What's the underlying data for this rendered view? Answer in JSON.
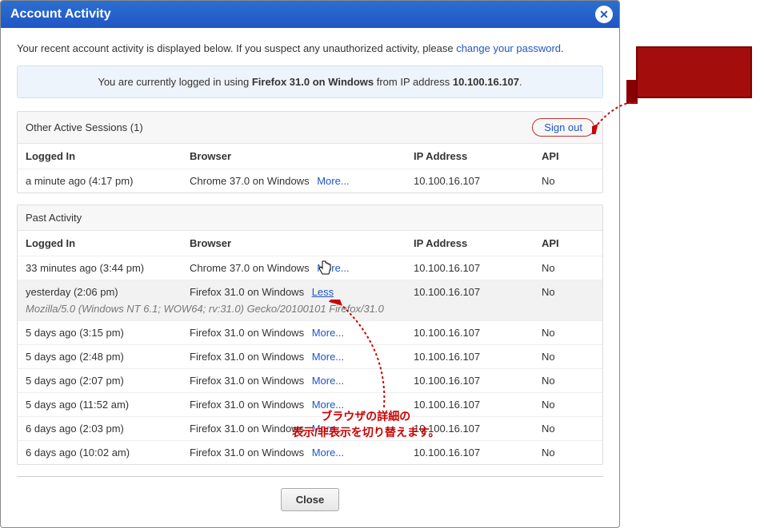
{
  "header": {
    "title": "Account Activity"
  },
  "intro": {
    "text": "Your recent account activity is displayed below. If you suspect any unauthorized activity, please ",
    "link": "change your password",
    "suffix": "."
  },
  "banner": {
    "prefix": "You are currently logged in using ",
    "browser": "Firefox 31.0 on Windows",
    "mid": " from IP address ",
    "ip": "10.100.16.107",
    "suffix": "."
  },
  "active_sessions": {
    "title": "Other Active Sessions (1)",
    "signout": "Sign out"
  },
  "columns": {
    "logged_in": "Logged In",
    "browser": "Browser",
    "ip": "IP Address",
    "api": "API"
  },
  "labels": {
    "more": "More...",
    "less": "Less",
    "close": "Close",
    "past_activity": "Past Activity"
  },
  "active_rows": [
    {
      "logged": "a minute ago (4:17 pm)",
      "browser": "Chrome 37.0 on Windows",
      "ip": "10.100.16.107",
      "api": "No"
    }
  ],
  "past_rows": [
    {
      "logged": "33 minutes ago (3:44 pm)",
      "browser": "Chrome 37.0 on Windows",
      "ip": "10.100.16.107",
      "api": "No",
      "expanded": false
    },
    {
      "logged": "yesterday (2:06 pm)",
      "browser": "Firefox 31.0 on Windows",
      "ip": "10.100.16.107",
      "api": "No",
      "expanded": true,
      "ua": "Mozilla/5.0 (Windows NT 6.1; WOW64; rv:31.0) Gecko/20100101 Firefox/31.0"
    },
    {
      "logged": "5 days ago (3:15 pm)",
      "browser": "Firefox 31.0 on Windows",
      "ip": "10.100.16.107",
      "api": "No",
      "expanded": false
    },
    {
      "logged": "5 days ago (2:48 pm)",
      "browser": "Firefox 31.0 on Windows",
      "ip": "10.100.16.107",
      "api": "No",
      "expanded": false
    },
    {
      "logged": "5 days ago (2:07 pm)",
      "browser": "Firefox 31.0 on Windows",
      "ip": "10.100.16.107",
      "api": "No",
      "expanded": false
    },
    {
      "logged": "5 days ago (11:52 am)",
      "browser": "Firefox 31.0 on Windows",
      "ip": "10.100.16.107",
      "api": "No",
      "expanded": false
    },
    {
      "logged": "6 days ago (2:03 pm)",
      "browser": "Firefox 31.0 on Windows",
      "ip": "10.100.16.107",
      "api": "No",
      "expanded": false
    },
    {
      "logged": "6 days ago (10:02 am)",
      "browser": "Firefox 31.0 on Windows",
      "ip": "10.100.16.107",
      "api": "No",
      "expanded": false
    }
  ],
  "annotation": {
    "jp1": "ブラウザの詳細の",
    "jp2": "表示/非表示を切り替えます。"
  }
}
